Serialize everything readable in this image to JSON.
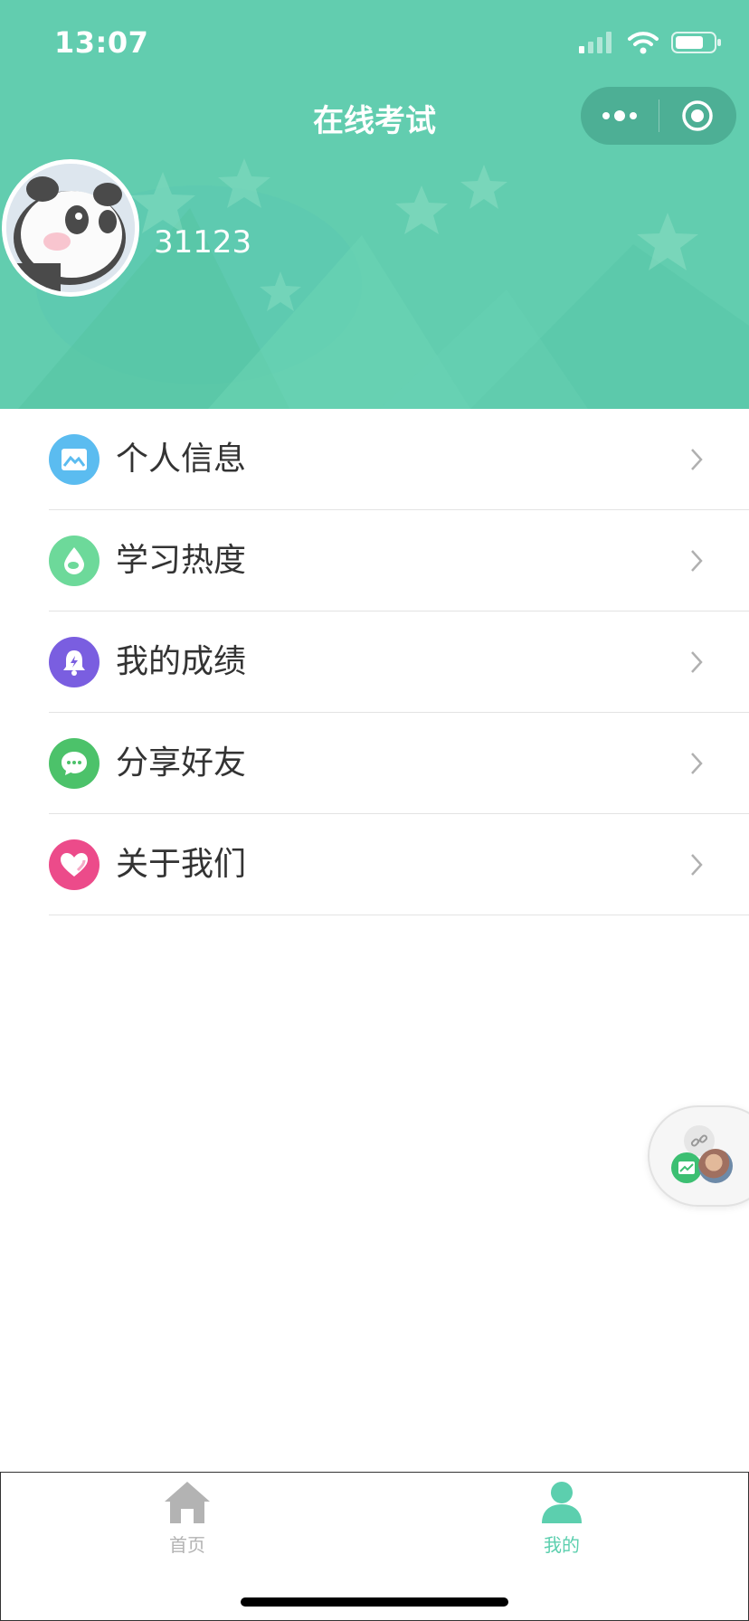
{
  "status_bar": {
    "time": "13:07"
  },
  "nav": {
    "title": "在线考试"
  },
  "profile": {
    "username": "31123"
  },
  "menu": {
    "items": [
      {
        "label": "个人信息",
        "icon": "image-icon",
        "color": "#5bbcf0"
      },
      {
        "label": "学习热度",
        "icon": "water-drop-icon",
        "color": "#6dd99a"
      },
      {
        "label": "我的成绩",
        "icon": "bell-icon",
        "color": "#7a5ee0"
      },
      {
        "label": "分享好友",
        "icon": "chat-bubble-icon",
        "color": "#4cc26a"
      },
      {
        "label": "关于我们",
        "icon": "heart-icon",
        "color": "#ec4b8a"
      }
    ]
  },
  "tabbar": {
    "items": [
      {
        "label": "首页",
        "icon": "home-icon",
        "active": false
      },
      {
        "label": "我的",
        "icon": "user-icon",
        "active": true
      }
    ]
  },
  "colors": {
    "brand": "#62cdaf",
    "tab_active": "#5ccfae",
    "tab_inactive": "#b3b3b3"
  }
}
